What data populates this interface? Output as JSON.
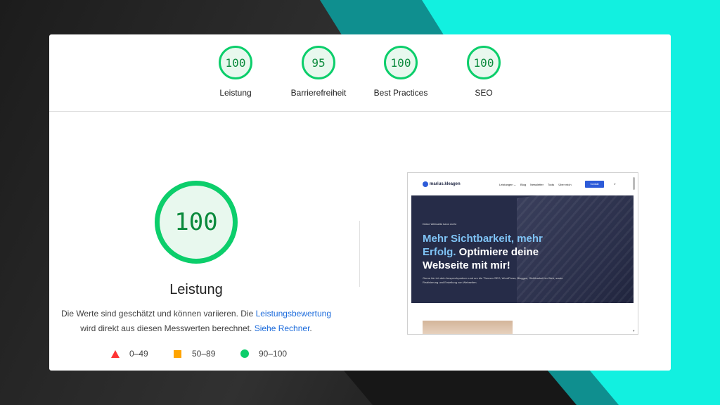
{
  "scores": [
    {
      "value": "100",
      "label": "Leistung"
    },
    {
      "value": "95",
      "label": "Barrierefreiheit"
    },
    {
      "value": "100",
      "label": "Best Practices"
    },
    {
      "value": "100",
      "label": "SEO"
    }
  ],
  "main": {
    "score": "100",
    "title": "Leistung",
    "desc_part1": "Die Werte sind geschätzt und können variieren. Die ",
    "desc_link1": "Leistungsbewertung",
    "desc_part2": " wird direkt aus diesen Messwerten berechnet. ",
    "desc_link2": "Siehe Rechner",
    "desc_part3": "."
  },
  "legend": [
    {
      "range": "0–49",
      "icon": "red-triangle-icon"
    },
    {
      "range": "50–89",
      "icon": "orange-square-icon"
    },
    {
      "range": "90–100",
      "icon": "green-circle-icon"
    }
  ],
  "preview": {
    "logo": "marius.kleagen",
    "menu": [
      "Leistungen ⌄",
      "Blog",
      "Newsletter",
      "Tools",
      "Über mich"
    ],
    "button": "Kontakt",
    "small": "Deine Webseite kann mehr",
    "headline_hl": "Mehr Sichtbarkeit, mehr Erfolg.",
    "headline_rest": " Optimiere deine Webseite mit mir!",
    "sub": "Gerne bin ich dein Ansprechpartner rund um die Themen SEO, WordPress, Bloggen, Sichtbarkeit im Web, sowie Realisierung und Erstellung von Webseiten."
  },
  "colors": {
    "pass": "#0cce6b",
    "average": "#ffa400",
    "fail": "#ff3333",
    "link": "#1a6adb",
    "teal": "#12f0e0"
  }
}
